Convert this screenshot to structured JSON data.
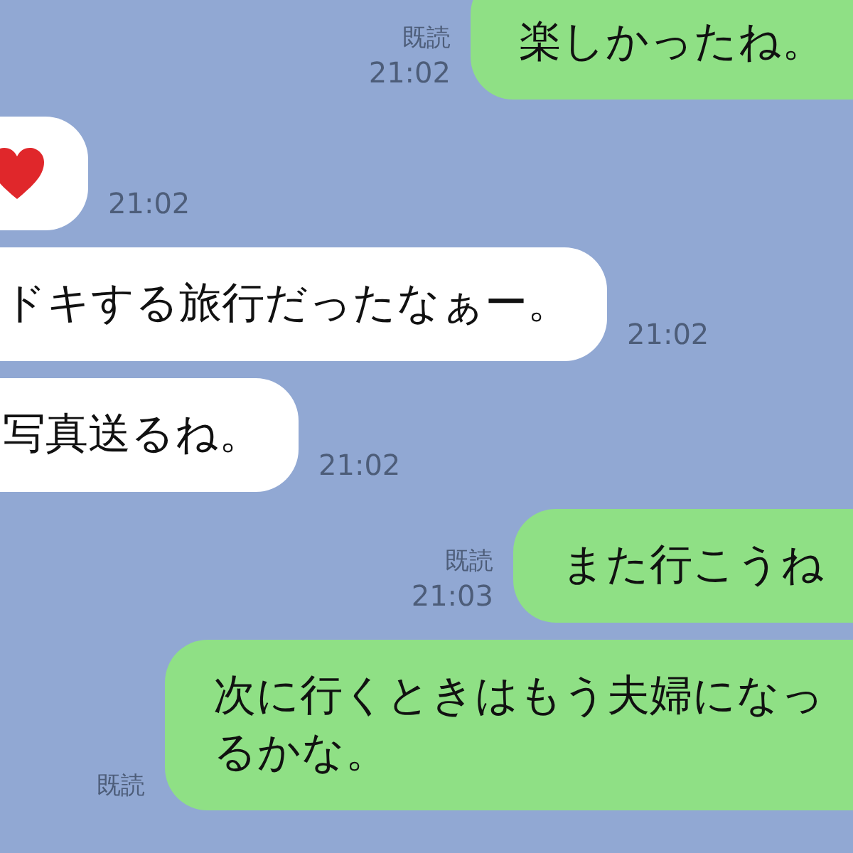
{
  "messages": [
    {
      "kind": "sent",
      "text": "楽しかったね。",
      "read": "既読",
      "time": "21:02"
    },
    {
      "kind": "heart",
      "time": "21:02"
    },
    {
      "kind": "received",
      "text": "ドキする旅行だったなぁー。",
      "time": "21:02"
    },
    {
      "kind": "received",
      "text": "写真送るね。",
      "time": "21:02"
    },
    {
      "kind": "sent",
      "text": "また行こうね",
      "read": "既読",
      "time": "21:03"
    },
    {
      "kind": "sent",
      "lines": [
        "次に行くときはもう夫婦になっ",
        "るかな。"
      ],
      "read": "既読"
    }
  ]
}
